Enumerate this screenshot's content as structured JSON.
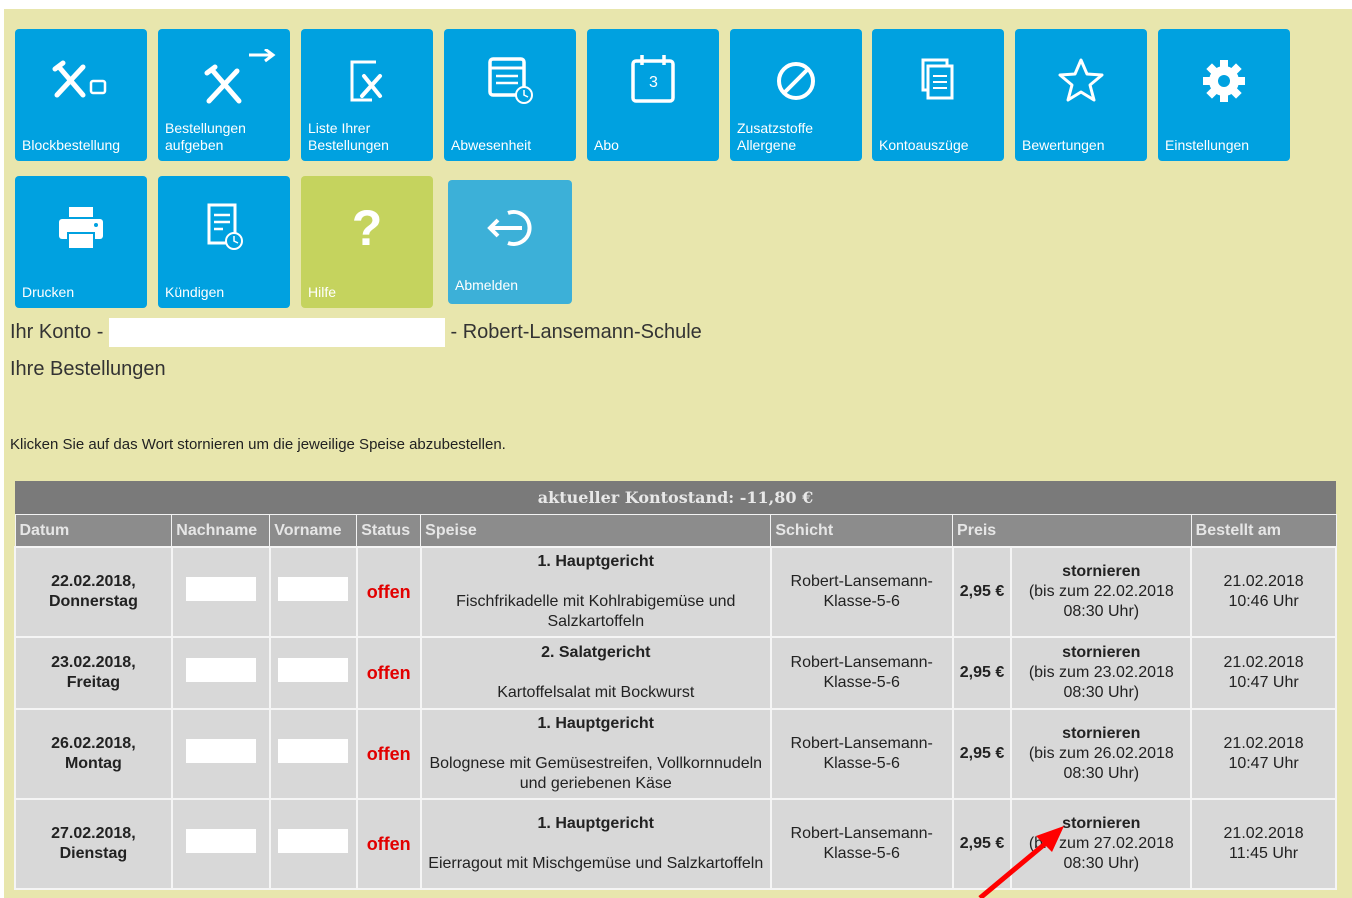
{
  "tiles_row1": [
    {
      "label": "Blockbestellung",
      "icon": "cutlery-tray-icon"
    },
    {
      "label": "Bestellungen aufgeben",
      "icon": "cutlery-arrow-icon"
    },
    {
      "label": "Liste Ihrer Bestellungen",
      "icon": "order-list-icon"
    },
    {
      "label": "Abwesenheit",
      "icon": "calendar-clock-icon"
    },
    {
      "label": "Abo",
      "icon": "calendar-3-icon"
    },
    {
      "label": "Zusatzstoffe Allergene",
      "icon": "prohibited-icon"
    },
    {
      "label": "Kontoauszüge",
      "icon": "documents-icon"
    },
    {
      "label": "Bewertungen",
      "icon": "star-icon"
    },
    {
      "label": "Einstellungen",
      "icon": "gear-icon"
    }
  ],
  "tiles_row2": [
    {
      "label": "Drucken",
      "icon": "printer-icon"
    },
    {
      "label": "Kündigen",
      "icon": "document-clock-icon"
    },
    {
      "label": "Hilfe",
      "icon": "question-icon"
    },
    {
      "label": "Abmelden",
      "icon": "logout-icon"
    }
  ],
  "account": {
    "prefix": "Ihr Konto -",
    "school": "- Robert-Lansemann-Schule"
  },
  "orders_title": "Ihre Bestellungen",
  "hint": "Klicken Sie auf das Wort stornieren um die jeweilige Speise abzubestellen.",
  "balance": "aktueller Kontostand: -11,80 €",
  "columns": [
    "Datum",
    "Nachname",
    "Vorname",
    "Status",
    "Speise",
    "Schicht",
    "Preis",
    "Bestellt am"
  ],
  "rows": [
    {
      "date": "22.02.2018,",
      "weekday": "Donnerstag",
      "status": "offen",
      "course": "1. Hauptgericht",
      "dish": "Fischfrikadelle mit Kohlrabigemüse und Salzkartoffeln",
      "shift": "Robert-Lansemann-Klasse-5-6",
      "price": "2,95 €",
      "cancel": "stornieren",
      "cancel_until": "(bis zum 22.02.2018 08:30 Uhr)",
      "ordered_date": "21.02.2018",
      "ordered_time": "10:46 Uhr"
    },
    {
      "date": "23.02.2018,",
      "weekday": "Freitag",
      "status": "offen",
      "course": "2. Salatgericht",
      "dish": "Kartoffelsalat mit Bockwurst",
      "shift": "Robert-Lansemann-Klasse-5-6",
      "price": "2,95 €",
      "cancel": "stornieren",
      "cancel_until": "(bis zum 23.02.2018 08:30 Uhr)",
      "ordered_date": "21.02.2018",
      "ordered_time": "10:47 Uhr"
    },
    {
      "date": "26.02.2018,",
      "weekday": "Montag",
      "status": "offen",
      "course": "1. Hauptgericht",
      "dish": "Bolognese mit Gemüsestreifen, Vollkornnudeln und geriebenen Käse",
      "shift": "Robert-Lansemann-Klasse-5-6",
      "price": "2,95 €",
      "cancel": "stornieren",
      "cancel_until": "(bis zum 26.02.2018 08:30 Uhr)",
      "ordered_date": "21.02.2018",
      "ordered_time": "10:47 Uhr"
    },
    {
      "date": "27.02.2018,",
      "weekday": "Dienstag",
      "status": "offen",
      "course": "1. Hauptgericht",
      "dish": "Eierragout mit Mischgemüse und Salzkartoffeln",
      "shift": "Robert-Lansemann-Klasse-5-6",
      "price": "2,95 €",
      "cancel": "stornieren",
      "cancel_until": "(bis zum 27.02.2018 08:30 Uhr)",
      "ordered_date": "21.02.2018",
      "ordered_time": "11:45 Uhr"
    }
  ],
  "colors": {
    "tile": "#00a1e0",
    "tile_help": "#c5d35e",
    "tile_logout": "#3cb0d8",
    "background": "#e8e6ad",
    "status_open": "#e20000",
    "annotation_arrow": "#ff0000"
  },
  "annotation": "red-arrow-icon"
}
